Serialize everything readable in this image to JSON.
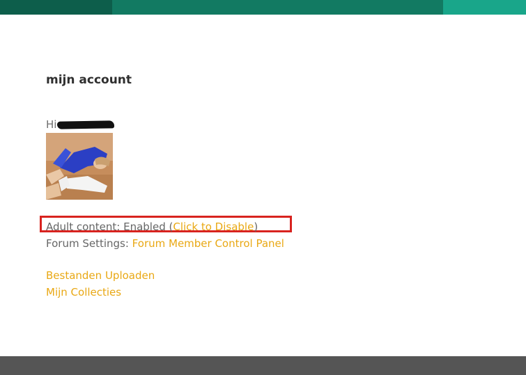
{
  "header": {
    "colors": [
      "#0d5e4b",
      "#127a62",
      "#19a68a"
    ]
  },
  "account": {
    "title": "mijn account",
    "greeting_prefix": "Hi"
  },
  "settings": {
    "adult_label": "Adult content: Enabled (",
    "adult_action": "Click to Disable",
    "adult_suffix": ")",
    "forum_label": "Forum Settings: ",
    "forum_link": "Forum Member Control Panel"
  },
  "links": {
    "upload": "Bestanden Uploaden",
    "collections": "Mijn Collecties"
  },
  "colors": {
    "link": "#e9a814",
    "highlight": "#d8231f",
    "footer": "#555555"
  }
}
